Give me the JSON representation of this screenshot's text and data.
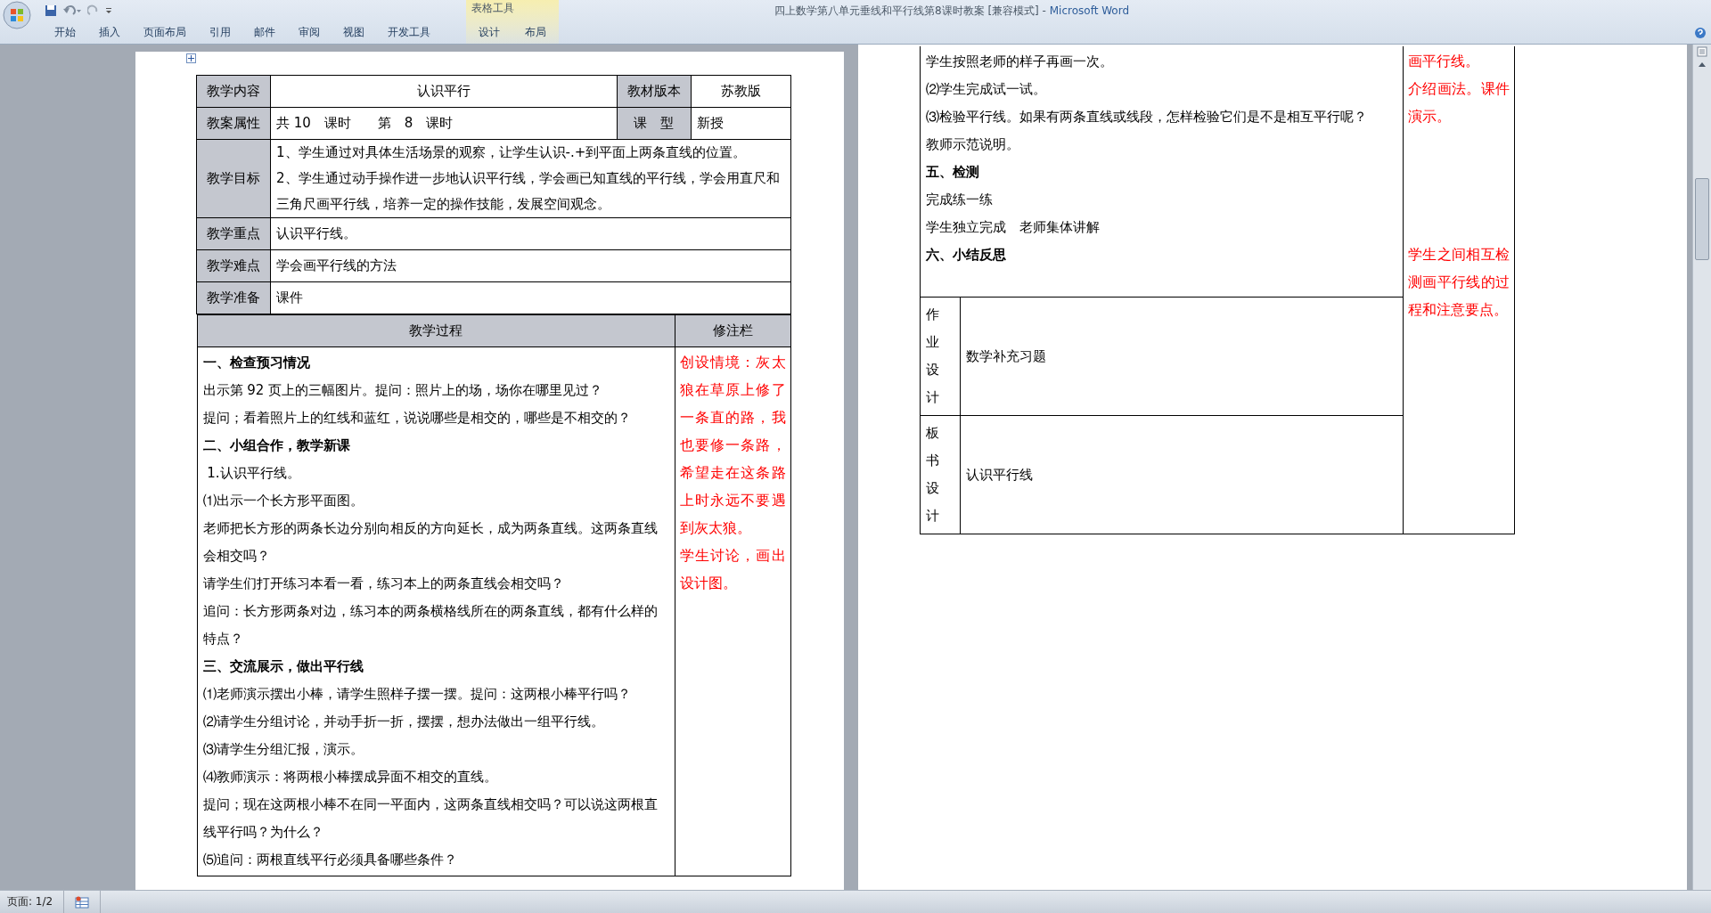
{
  "window": {
    "document_title": "四上数学第八单元垂线和平行线第8课时教案 [兼容模式]",
    "separator": "-",
    "app_name": "Microsoft Word"
  },
  "ribbon": {
    "tabs": [
      {
        "label": "开始"
      },
      {
        "label": "插入"
      },
      {
        "label": "页面布局"
      },
      {
        "label": "引用"
      },
      {
        "label": "邮件"
      },
      {
        "label": "审阅"
      },
      {
        "label": "视图"
      },
      {
        "label": "开发工具"
      }
    ],
    "context_group": {
      "label": "表格工具",
      "tabs": [
        {
          "label": "设计"
        },
        {
          "label": "布局"
        }
      ]
    }
  },
  "page_1": {
    "info_rows": [
      {
        "cells": [
          {
            "kind": "label",
            "text": "教学内容"
          },
          {
            "kind": "center",
            "text": "认识平行"
          },
          {
            "kind": "label",
            "text": "教材版本"
          },
          {
            "kind": "center",
            "text": "苏教版"
          }
        ]
      },
      {
        "cells": [
          {
            "kind": "label",
            "text": "教案属性"
          },
          {
            "kind": "value",
            "text": "共 10　课时　　第　8　课时"
          },
          {
            "kind": "label",
            "text": "课　型"
          },
          {
            "kind": "value",
            "text": "新授"
          }
        ]
      },
      {
        "cells": [
          {
            "kind": "label",
            "text": "教学目标"
          },
          {
            "kind": "wide",
            "paragraphs": [
              "1、学生通过对具体生活场景的观察，让学生认识-.+到平面上两条直线的位置。",
              "2、学生通过动手操作进一步地认识平行线，学会画已知直线的平行线，学会用直尺和三角尺画平行线，培养一定的操作技能，发展空间观念。"
            ]
          }
        ]
      },
      {
        "cells": [
          {
            "kind": "label",
            "text": "教学重点"
          },
          {
            "kind": "wide",
            "paragraphs": [
              "认识平行线。"
            ]
          }
        ]
      },
      {
        "cells": [
          {
            "kind": "label",
            "text": "教学难点"
          },
          {
            "kind": "wide",
            "paragraphs": [
              "学会画平行线的方法"
            ]
          }
        ]
      },
      {
        "cells": [
          {
            "kind": "label",
            "text": "教学准备"
          },
          {
            "kind": "wide",
            "paragraphs": [
              "课件"
            ]
          }
        ]
      }
    ],
    "process_header": "教学过程",
    "notes_header": "修注栏",
    "process_lines": [
      {
        "kind": "heading",
        "text": "一、检查预习情况"
      },
      {
        "kind": "body",
        "text": "出示第 92 页上的三幅图片。提问：照片上的场，场你在哪里见过？"
      },
      {
        "kind": "body",
        "text": "提问；看着照片上的红线和蓝红，说说哪些是相交的，哪些是不相交的？"
      },
      {
        "kind": "heading",
        "text": "二、小组合作，教学新课"
      },
      {
        "kind": "body",
        "text": " 1.认识平行线。"
      },
      {
        "kind": "body",
        "text": "⑴出示一个长方形平面图。"
      },
      {
        "kind": "body",
        "text": "老师把长方形的两条长边分别向相反的方向延长，成为两条直线。这两条直线会相交吗？"
      },
      {
        "kind": "body",
        "text": "请学生们打开练习本看一看，练习本上的两条直线会相交吗？"
      },
      {
        "kind": "body",
        "text": "追问：长方形两条对边，练习本的两条横格线所在的两条直线，都有什么样的特点？"
      },
      {
        "kind": "heading",
        "text": "三、交流展示，做出平行线"
      },
      {
        "kind": "body",
        "text": "⑴老师演示摆出小棒，请学生照样子摆一摆。提问：这两根小棒平行吗？"
      },
      {
        "kind": "body",
        "text": "⑵请学生分组讨论，并动手折一折，摆摆，想办法做出一组平行线。"
      },
      {
        "kind": "body",
        "text": "⑶请学生分组汇报，演示。"
      },
      {
        "kind": "body",
        "text": "⑷教师演示：将两根小棒摆成异面不相交的直线。"
      },
      {
        "kind": "body",
        "text": "提问；现在这两根小棒不在同一平面内，这两条直线相交吗？可以说这两根直线平行吗？为什么？"
      },
      {
        "kind": "body",
        "text": "⑸追问：两根直线平行必须具备哪些条件？"
      }
    ],
    "notes": [
      "创设情境：灰太狼在草原上修了一条直的路，我也要修一条路，希望走在这条路上时永远不要遇到灰太狼。",
      "学生讨论，画出设计图。"
    ]
  },
  "page_2": {
    "process_lines": [
      {
        "kind": "body",
        "text": "学生按照老师的样子再画一次。"
      },
      {
        "kind": "body",
        "text": "⑵学生完成试一试。"
      },
      {
        "kind": "body",
        "text": "⑶检验平行线。如果有两条直线或线段，怎样检验它们是不是相互平行呢？"
      },
      {
        "kind": "body",
        "text": "教师示范说明。"
      },
      {
        "kind": "heading",
        "text": "五、检测"
      },
      {
        "kind": "body",
        "text": "完成练一练"
      },
      {
        "kind": "body",
        "text": "学生独立完成　老师集体讲解"
      },
      {
        "kind": "heading",
        "text": "六、小结反思"
      }
    ],
    "sub_rows": [
      {
        "label": "作业设计",
        "text": "数学补充习题"
      },
      {
        "label": "板书设计",
        "text": "认识平行线"
      }
    ],
    "notes": [
      "画平行线。",
      "介绍画法。课件演示。",
      "学生之间相互检测画平行线的过程和注意要点。"
    ]
  },
  "status_bar": {
    "page": "页面: 1/2"
  }
}
